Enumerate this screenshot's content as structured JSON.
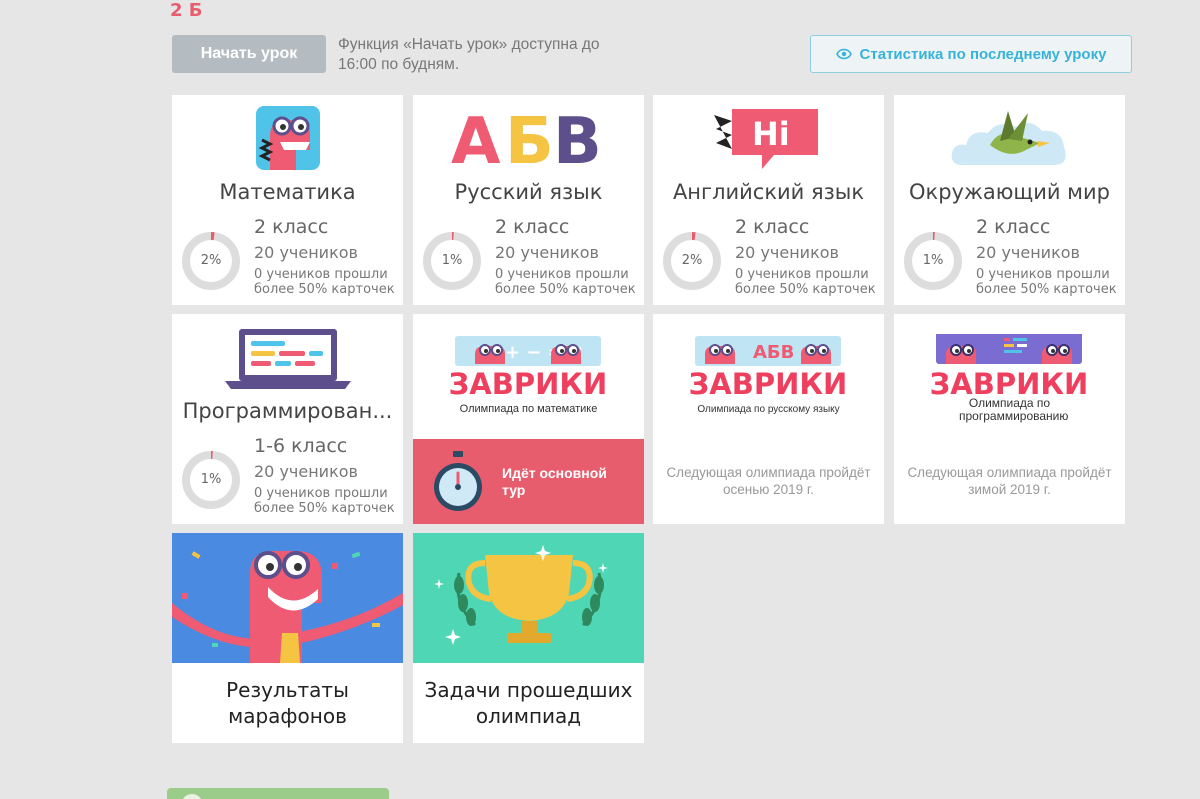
{
  "class_title": "2 Б",
  "toolbar": {
    "start_lesson_label": "Начать урок",
    "start_lesson_note": "Функция «Начать урок» доступна до 16:00 по будням.",
    "stats_label": "Статистика по последнему уроку",
    "stats_icon": "eye-icon"
  },
  "subjects": [
    {
      "name": "Математика",
      "grade": "2 класс",
      "students": "20 учеников",
      "passed": "0 учеников прошли более 50% карточек",
      "progress_label": "2%",
      "progress": 0.02
    },
    {
      "name": "Русский язык",
      "grade": "2 класс",
      "students": "20 учеников",
      "passed": "0 учеников прошли более 50% карточек",
      "progress_label": "1%",
      "progress": 0.01,
      "logo_letters": [
        "А",
        "Б",
        "В"
      ]
    },
    {
      "name": "Английский язык",
      "grade": "2 класс",
      "students": "20 учеников",
      "passed": "0 учеников прошли более 50% карточек",
      "progress_label": "2%",
      "progress": 0.02,
      "logo_text": "Hi"
    },
    {
      "name": "Окружающий мир",
      "grade": "2 класс",
      "students": "20 учеников",
      "passed": "0 учеников прошли более 50% карточек",
      "progress_label": "1%",
      "progress": 0.01
    },
    {
      "name": "Программирован...",
      "grade": "1-6 класс",
      "students": "20 учеников",
      "passed": "0 учеников прошли более 50% карточек",
      "progress_label": "1%",
      "progress": 0.01
    }
  ],
  "olympiads": [
    {
      "brand": "ЗАВРИКИ",
      "subtitle": "Олимпиада по математике",
      "status": "Идёт основной тур"
    },
    {
      "brand": "ЗАВРИКИ",
      "logo_letters": "АБВ",
      "subtitle": "Олимпиада по русскому языку",
      "next": "Следующая олимпиада пройдёт осенью 2019 г."
    },
    {
      "brand": "ЗАВРИКИ",
      "subtitle": "Олимпиада по программированию",
      "next": "Следующая олимпиада пройдёт зимой 2019 г."
    }
  ],
  "extras": [
    {
      "title": "Результаты марафонов"
    },
    {
      "title": "Задачи прошедших олимпиад"
    }
  ],
  "colors": {
    "accent_red": "#e85d6d",
    "accent_blue": "#37b3d8",
    "purple": "#5d4e8c",
    "yellow": "#f6c443",
    "teal": "#4fd6b4"
  }
}
